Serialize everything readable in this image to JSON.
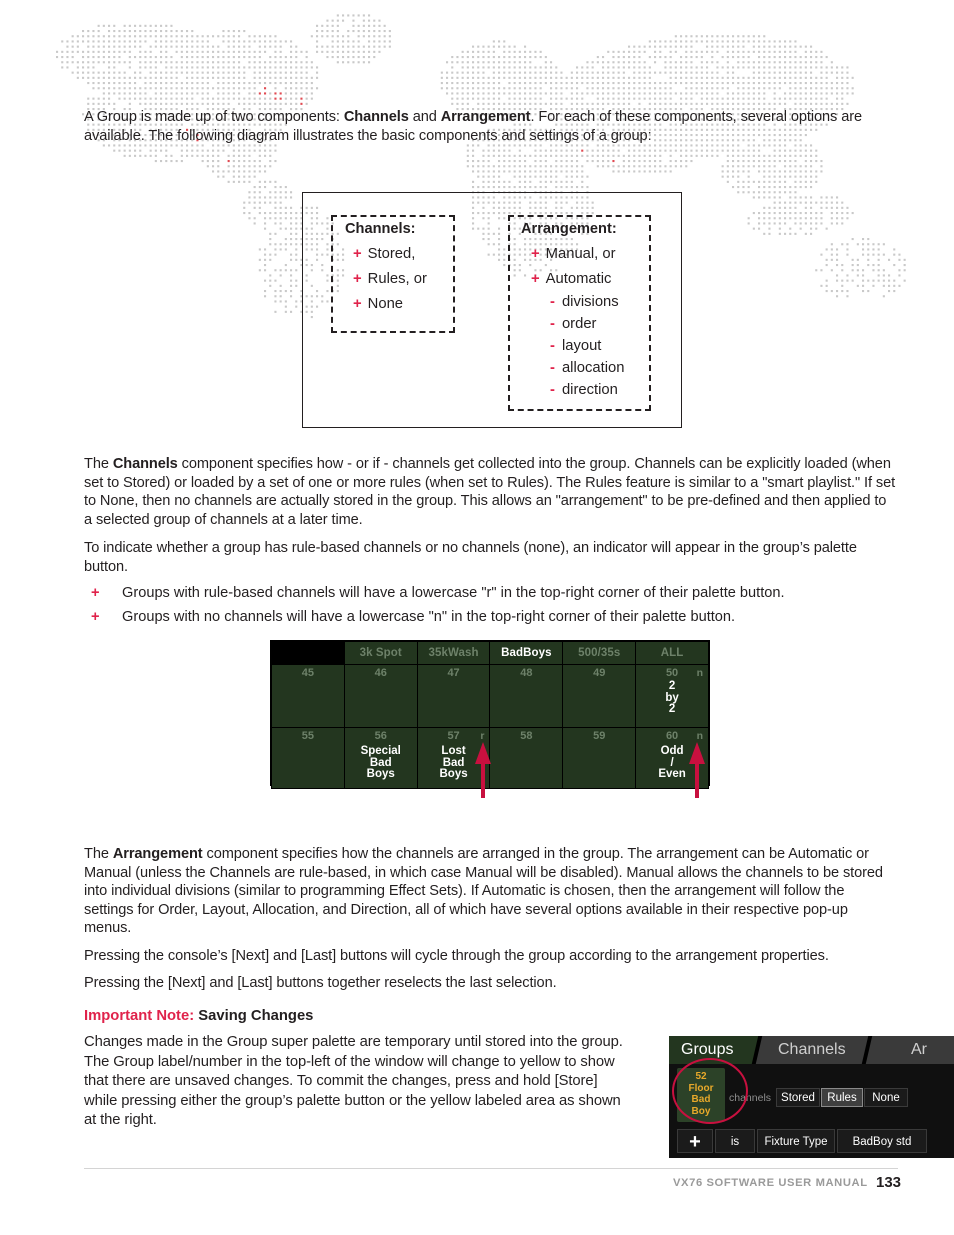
{
  "intro": {
    "paragraph_html": "A Group is made up of two components: <b>Channels</b> and <b>Arrangement</b>. For each of these components, several options are available. The following diagram illustrates the basic components and settings of a group:"
  },
  "diagram": {
    "channels": {
      "heading": "Channels:",
      "items": [
        {
          "bullet": "+",
          "label": "Stored,"
        },
        {
          "bullet": "+",
          "label": "Rules, or"
        },
        {
          "bullet": "+",
          "label": "None"
        }
      ]
    },
    "arrangement": {
      "heading": "Arrangement:",
      "items": [
        {
          "bullet": "+",
          "label": "Manual, or"
        },
        {
          "bullet": "+",
          "label": "Automatic"
        },
        {
          "bullet": "-",
          "label": "divisions"
        },
        {
          "bullet": "-",
          "label": "order"
        },
        {
          "bullet": "-",
          "label": "layout"
        },
        {
          "bullet": "-",
          "label": "allocation"
        },
        {
          "bullet": "-",
          "label": "direction"
        }
      ]
    }
  },
  "body": {
    "channels_para_html": "The <b>Channels</b> component specifies how - or if - channels get collected into the group. Channels can be explicitly loaded (when set to Stored) or loaded by a set of one or more rules (when set to Rules). The Rules feature is similar to a \"smart playlist.\" If set to None, then no channels are actually stored in the group. This allows an \"arrangement\" to be pre-defined and then applied to a selected group of channels at a later time.",
    "indicator_para": "To indicate whether a group has rule-based channels or no channels (none), an indicator will appear in the group’s palette button.",
    "bullets": [
      {
        "marker": "+",
        "text": "Groups with rule-based channels will have a lowercase \"r\" in the top-right corner of their palette button."
      },
      {
        "marker": "+",
        "text": "Groups with no channels will have a lowercase \"n\" in the top-right corner of their palette button."
      }
    ],
    "arrangement_para_html": "The <b>Arrangement</b> component specifies how the channels are arranged in the group. The arrangement can be Automatic or Manual (unless the Channels are rule-based, in which case Manual will be disabled). Manual allows the channels to be stored into individual divisions (similar to programming Effect Sets). If Automatic is chosen, then the arrangement will follow the settings for Order, Layout, Allocation, and Direction, all of which have several options available in their respective pop-up menus.",
    "next_last_para": "Pressing the console’s [Next] and [Last] buttons will cycle through the group according to the arrangement properties.",
    "reselect_para": "Pressing the [Next] and [Last] buttons together reselects the last selection."
  },
  "note": {
    "label": "Important Note:",
    "title": "Saving Changes",
    "paragraph": "Changes made in the Group super palette are temporary until stored into the group. The Group label/number in the top-left of the window will change to yellow to show that there are unsaved changes. To commit the changes, press and hold [Store] while pressing either the group’s palette button or the yellow labeled area as shown at the right."
  },
  "palette_grid": {
    "header": [
      {
        "label": "",
        "active": false,
        "blank": true
      },
      {
        "label": "3k Spot",
        "active": false
      },
      {
        "label": "35kWash",
        "active": false
      },
      {
        "label": "BadBoys",
        "active": true
      },
      {
        "label": "500/35s",
        "active": false
      },
      {
        "label": "ALL",
        "active": false
      }
    ],
    "row1": [
      {
        "number": "45",
        "indicator": "",
        "text": ""
      },
      {
        "number": "46",
        "indicator": "",
        "text": ""
      },
      {
        "number": "47",
        "indicator": "",
        "text": ""
      },
      {
        "number": "48",
        "indicator": "",
        "text": ""
      },
      {
        "number": "49",
        "indicator": "",
        "text": ""
      },
      {
        "number": "50",
        "indicator": "n",
        "text": "2\nby\n2"
      }
    ],
    "row2": [
      {
        "number": "55",
        "indicator": "",
        "text": ""
      },
      {
        "number": "56",
        "indicator": "",
        "text": "Special\nBad\nBoys"
      },
      {
        "number": "57",
        "indicator": "r",
        "text": "Lost\nBad\nBoys"
      },
      {
        "number": "58",
        "indicator": "",
        "text": ""
      },
      {
        "number": "59",
        "indicator": "",
        "text": ""
      },
      {
        "number": "60",
        "indicator": "n",
        "text": "Odd\n/\nEven"
      }
    ],
    "callout_arrow_color": "#c8103f"
  },
  "console": {
    "tabs": [
      {
        "label": "Groups",
        "active": true
      },
      {
        "label": "Channels",
        "active": false
      },
      {
        "label": "Ar",
        "active": false
      }
    ],
    "group_button": {
      "number": "52",
      "lines": [
        "Floor",
        "Bad",
        "Boy"
      ],
      "text_color": "#e8a92a"
    },
    "channels_label": "channels",
    "channel_mode_options": [
      {
        "label": "Stored",
        "selected": false
      },
      {
        "label": "Rules",
        "selected": true
      },
      {
        "label": "None",
        "selected": false
      }
    ],
    "rule_row": [
      {
        "label": "+"
      },
      {
        "label": "is"
      },
      {
        "label": "Fixture Type"
      },
      {
        "label": "BadBoy std"
      }
    ]
  },
  "footer": {
    "manual": "VX76 SOFTWARE USER MANUAL",
    "page": "133"
  },
  "colors": {
    "accent_red": "#e0234b",
    "callout_red": "#c8103f",
    "console_green": "#23361f",
    "amber": "#e8a92a",
    "text": "#231f20"
  }
}
